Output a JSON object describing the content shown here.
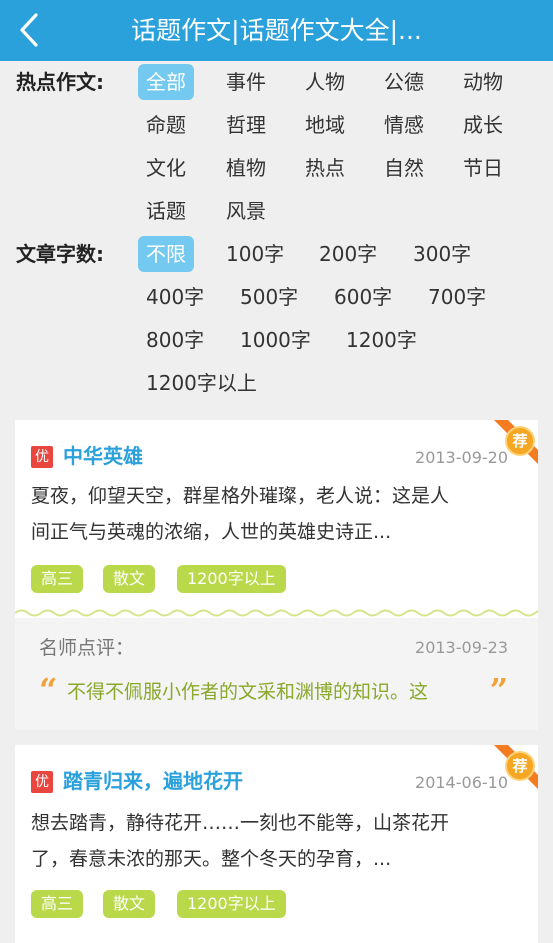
{
  "header": {
    "title": "话题作文|话题作文大全|..."
  },
  "filters": {
    "topic_label": "热点作文:",
    "topics": [
      "全部",
      "事件",
      "人物",
      "公德",
      "动物",
      "命题",
      "哲理",
      "地域",
      "情感",
      "成长",
      "文化",
      "植物",
      "热点",
      "自然",
      "节日",
      "话题",
      "风景"
    ],
    "topic_selected": "全部",
    "count_label": "文章字数:",
    "counts": [
      "不限",
      "100字",
      "200字",
      "300字",
      "400字",
      "500字",
      "600字",
      "700字",
      "800字",
      "1000字",
      "1200字",
      "1200字以上"
    ],
    "count_selected": "不限"
  },
  "articles": [
    {
      "badge": "优",
      "title": "中华英雄",
      "date": "2013-09-20",
      "ribbon": "荐",
      "excerpt_line1": "夏夜，仰望天空，群星格外璀璨，老人说：这是人",
      "excerpt_line2": "间正气与英魂的浓缩，人世的英雄史诗正...",
      "tags": [
        "高三",
        "散文",
        "1200字以上"
      ],
      "review_label": "名师点评：",
      "review_date": "2013-09-23",
      "review_text": "不得不佩服小作者的文采和渊博的知识。这",
      "quote_open": "“",
      "quote_close": "”"
    },
    {
      "badge": "优",
      "title": "踏青归来，遍地花开",
      "date": "2014-06-10",
      "ribbon": "荐",
      "excerpt_line1": "想去踏青，静待花开……一刻也不能等，山茶花开",
      "excerpt_line2": "了，春意未浓的那天。整个冬天的孕育，...",
      "tags": [
        "高三",
        "散文",
        "1200字以上"
      ]
    }
  ],
  "colors": {
    "header": "#2ba1dc",
    "selected": "#74c9f0",
    "tag": "#b9d84a",
    "badge": "#e8463f",
    "ribbon": "#f47b20",
    "medal": "#f5a623",
    "review_text": "#8aa82a"
  }
}
